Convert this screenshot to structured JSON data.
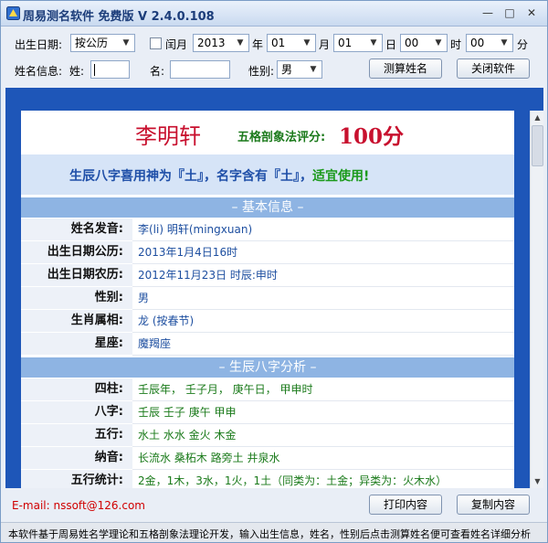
{
  "window": {
    "title": "周易测名软件 免费版  V 2.4.0.108",
    "minimize": "—",
    "maximize": "□",
    "close": "✕"
  },
  "toolbar": {
    "birth_date_label": "出生日期:",
    "calendar_type": "按公历",
    "leap_month_label": "闰月",
    "year_value": "2013",
    "year_unit": "年",
    "month_value": "01",
    "month_unit": "月",
    "day_value": "01",
    "day_unit": "日",
    "hour_value": "00",
    "hour_unit": "时",
    "minute_value": "00",
    "minute_unit": "分",
    "name_info_label": "姓名信息:",
    "surname_label": "姓:",
    "surname_value": "",
    "given_name_label": "名:",
    "given_name_value": "",
    "gender_label": "性别:",
    "gender_value": "男",
    "calculate_button": "测算姓名",
    "close_button": "关闭软件"
  },
  "result": {
    "name": "李明轩",
    "score_label": "五格剖象法评分:",
    "score_value": "100分",
    "bazi_prefix": "生辰八字喜用神为『土』，名字含有『土』，",
    "bazi_verdict": "适宜使用!",
    "basic_section_title": "–  基本信息  –",
    "basic_rows": [
      {
        "key": "姓名发音:",
        "value": "李(li) 明轩(mingxuan)"
      },
      {
        "key": "出生日期公历:",
        "value": "2013年1月4日16时"
      },
      {
        "key": "出生日期农历:",
        "value": "2012年11月23日 时辰:申时"
      },
      {
        "key": "性别:",
        "value": "男"
      },
      {
        "key": "生肖属相:",
        "value": "龙 (按春节)"
      },
      {
        "key": "星座:",
        "value": "魔羯座"
      }
    ],
    "bazi_section_title": "–  生辰八字分析  –",
    "bazi_rows": [
      {
        "key": "四柱:",
        "value": "壬辰年，  壬子月，  庚午日，  甲申时"
      },
      {
        "key": "八字:",
        "value": "壬辰  壬子  庚午  甲申"
      },
      {
        "key": "五行:",
        "value": "水土  水水  金火  木金"
      },
      {
        "key": "纳音:",
        "value": "长流水  桑柘木  路旁土  井泉水"
      },
      {
        "key": "五行统计:",
        "value": "2金，1木，3水，1火，1土（同类为：土金；异类为：火木水）"
      }
    ]
  },
  "footer": {
    "email": "E-mail:  nssoft@126.com",
    "print_button": "打印内容",
    "copy_button": "复制内容"
  },
  "status": {
    "text": "本软件基于周易姓名学理论和五格剖象法理论开发，输入出生信息，姓名，性别后点击测算姓名便可查看姓名详细分析"
  },
  "colors": {
    "accent": "#1e56b8",
    "name_red": "#c8102e",
    "section_blue": "#8eb4e3"
  }
}
